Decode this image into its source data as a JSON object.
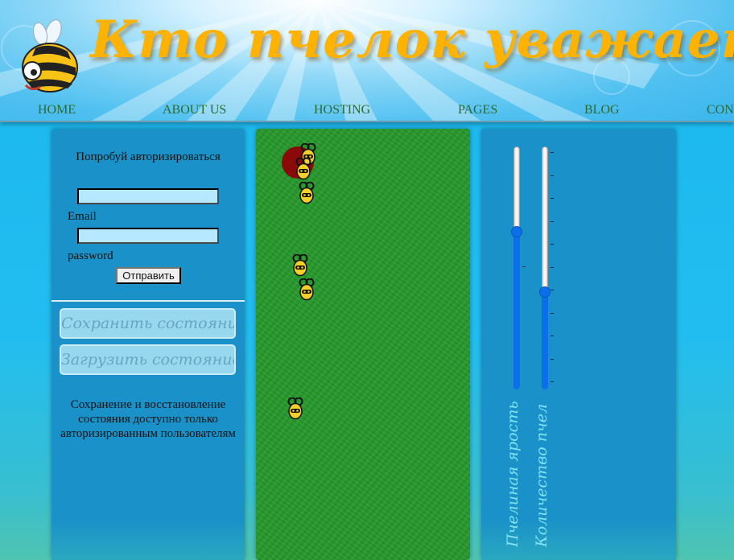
{
  "header": {
    "title": "Кто пчелок уважает !!!",
    "logo_icon": "bee-mascot-icon"
  },
  "nav": {
    "items": [
      "HOME",
      "ABOUT US",
      "HOSTING",
      "PAGES",
      "BLOG",
      "CON"
    ]
  },
  "auth": {
    "title": "Попробуй авторизироваться",
    "email_label": "Email",
    "email_value": "",
    "password_label": "password",
    "password_value": "",
    "submit_label": "Отправить"
  },
  "state": {
    "save_label": "Сохранить состояние",
    "load_label": "Загрузить состояние",
    "note": "Сохранение и восстановление состояния доступно только авторизированным пользователям"
  },
  "game": {
    "hive_icon": "beehive-circle-icon",
    "bee_icon": "bee-icon",
    "bee_count_visible": 6
  },
  "controls": {
    "rage_label": "Пчелиная ярость",
    "count_label": "Количество пчел",
    "rage_level": 0.35,
    "count_level": 0.6
  },
  "colors": {
    "title": "#ffb300",
    "nav": "#2d6a33",
    "panel": "#1a91c8",
    "grass": "#279a2c",
    "hive": "#8a0a0a",
    "slider": "#0a6fe8",
    "vertical_label": "#7fe4f4"
  }
}
